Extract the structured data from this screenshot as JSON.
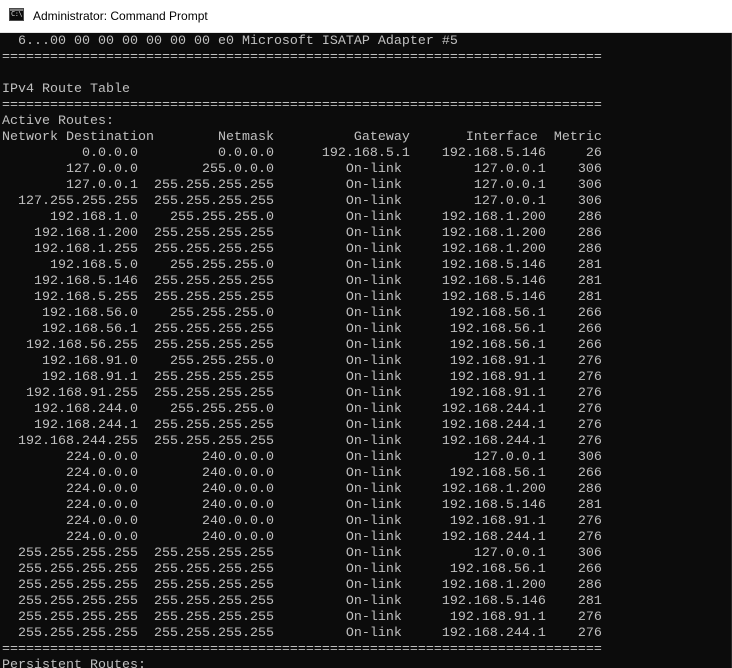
{
  "window": {
    "title": "Administrator: Command Prompt",
    "icon": "command-prompt-icon",
    "icon_glyph": "C:\\"
  },
  "colors": {
    "console_background": "#0c0c0c",
    "console_text": "#c0c0c0",
    "titlebar_background": "#ffffff"
  },
  "console": {
    "lines": [
      "  6...00 00 00 00 00 00 00 e0 Microsoft ISATAP Adapter #5",
      "===========================================================================",
      "",
      "IPv4 Route Table",
      "===========================================================================",
      "Active Routes:",
      "Network Destination        Netmask          Gateway       Interface  Metric",
      "          0.0.0.0          0.0.0.0      192.168.5.1    192.168.5.146     26",
      "        127.0.0.0        255.0.0.0         On-link         127.0.0.1    306",
      "        127.0.0.1  255.255.255.255         On-link         127.0.0.1    306",
      "  127.255.255.255  255.255.255.255         On-link         127.0.0.1    306",
      "      192.168.1.0    255.255.255.0         On-link     192.168.1.200    286",
      "    192.168.1.200  255.255.255.255         On-link     192.168.1.200    286",
      "    192.168.1.255  255.255.255.255         On-link     192.168.1.200    286",
      "      192.168.5.0    255.255.255.0         On-link     192.168.5.146    281",
      "    192.168.5.146  255.255.255.255         On-link     192.168.5.146    281",
      "    192.168.5.255  255.255.255.255         On-link     192.168.5.146    281",
      "     192.168.56.0    255.255.255.0         On-link      192.168.56.1    266",
      "     192.168.56.1  255.255.255.255         On-link      192.168.56.1    266",
      "   192.168.56.255  255.255.255.255         On-link      192.168.56.1    266",
      "     192.168.91.0    255.255.255.0         On-link      192.168.91.1    276",
      "     192.168.91.1  255.255.255.255         On-link      192.168.91.1    276",
      "   192.168.91.255  255.255.255.255         On-link      192.168.91.1    276",
      "    192.168.244.0    255.255.255.0         On-link     192.168.244.1    276",
      "    192.168.244.1  255.255.255.255         On-link     192.168.244.1    276",
      "  192.168.244.255  255.255.255.255         On-link     192.168.244.1    276",
      "        224.0.0.0        240.0.0.0         On-link         127.0.0.1    306",
      "        224.0.0.0        240.0.0.0         On-link      192.168.56.1    266",
      "        224.0.0.0        240.0.0.0         On-link     192.168.1.200    286",
      "        224.0.0.0        240.0.0.0         On-link     192.168.5.146    281",
      "        224.0.0.0        240.0.0.0         On-link      192.168.91.1    276",
      "        224.0.0.0        240.0.0.0         On-link     192.168.244.1    276",
      "  255.255.255.255  255.255.255.255         On-link         127.0.0.1    306",
      "  255.255.255.255  255.255.255.255         On-link      192.168.56.1    266",
      "  255.255.255.255  255.255.255.255         On-link     192.168.1.200    286",
      "  255.255.255.255  255.255.255.255         On-link     192.168.5.146    281",
      "  255.255.255.255  255.255.255.255         On-link      192.168.91.1    276",
      "  255.255.255.255  255.255.255.255         On-link     192.168.244.1    276",
      "===========================================================================",
      "Persistent Routes:"
    ]
  }
}
